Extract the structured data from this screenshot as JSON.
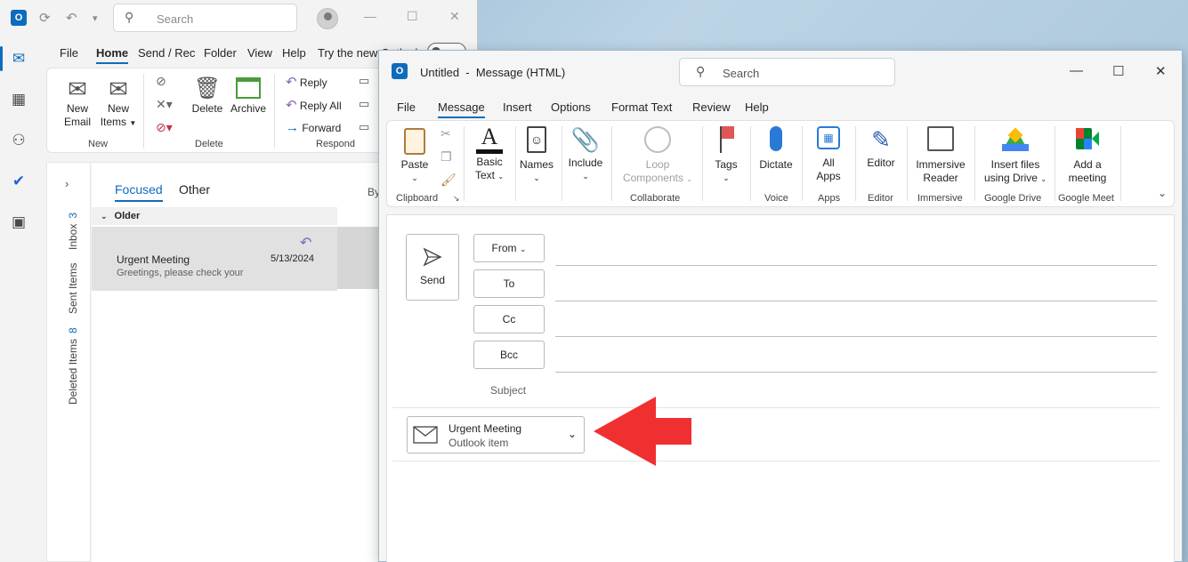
{
  "main_window": {
    "search_placeholder": "Search",
    "menu_tabs": [
      "File",
      "Home",
      "Send / Rec",
      "Folder",
      "View",
      "Help",
      "Try the new Outlook"
    ],
    "ribbon": {
      "new_email": [
        "New",
        "Email"
      ],
      "new_items": [
        "New",
        "Items"
      ],
      "delete": "Delete",
      "archive": "Archive",
      "reply": "Reply",
      "reply_all": "Reply All",
      "forward": "Forward",
      "groups": {
        "new": "New",
        "delete": "Delete",
        "respond": "Respond"
      }
    },
    "folders": [
      {
        "label": "Inbox",
        "count": "3"
      },
      {
        "label": "Sent Items",
        "count": ""
      },
      {
        "label": "Deleted Items",
        "count": "8"
      }
    ],
    "message_list": {
      "tab_focused": "Focused",
      "tab_other": "Other",
      "sort_label": "By",
      "section": "Older",
      "item": {
        "subject": "Urgent Meeting",
        "preview": "Greetings, please check your",
        "date": "5/13/2024"
      }
    }
  },
  "compose_window": {
    "title": "Untitled  -  Message (HTML)",
    "search_placeholder": "Search",
    "menu_tabs": [
      "File",
      "Message",
      "Insert",
      "Options",
      "Format Text",
      "Review",
      "Help"
    ],
    "ribbon": {
      "paste": "Paste",
      "basic_text": [
        "Basic",
        "Text"
      ],
      "names": "Names",
      "include": "Include",
      "loop_components": [
        "Loop",
        "Components"
      ],
      "tags": "Tags",
      "dictate": "Dictate",
      "all_apps": [
        "All",
        "Apps"
      ],
      "editor": "Editor",
      "immersive_reader": [
        "Immersive",
        "Reader"
      ],
      "insert_files_drive": [
        "Insert files",
        "using Drive"
      ],
      "add_meeting": [
        "Add a",
        "meeting"
      ],
      "groups": {
        "clipboard": "Clipboard",
        "collaborate": "Collaborate",
        "voice": "Voice",
        "apps": "Apps",
        "editor": "Editor",
        "immersive": "Immersive",
        "google_drive": "Google Drive",
        "google_meet": "Google Meet"
      }
    },
    "send": "Send",
    "from": "From",
    "to": "To",
    "cc": "Cc",
    "bcc": "Bcc",
    "subject_label": "Subject",
    "attachment": {
      "name": "Urgent Meeting",
      "type": "Outlook item"
    },
    "arrow_color": "#f03030"
  }
}
